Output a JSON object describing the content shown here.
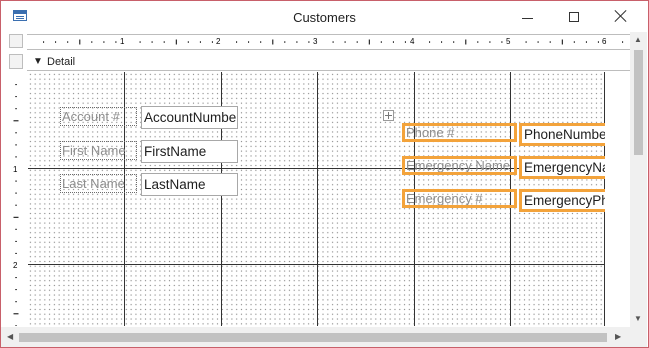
{
  "window": {
    "title": "Customers",
    "app_icon": "form-icon",
    "accent_border": "#c8606a"
  },
  "ruler": {
    "horizontal_marks": [
      "1",
      "2",
      "3",
      "4",
      "5",
      "6"
    ],
    "vertical_marks": [
      "1",
      "2"
    ]
  },
  "section": {
    "arrow": "▼",
    "label": "Detail"
  },
  "controls": {
    "account_label": "Account #",
    "account_field": "AccountNumber",
    "firstname_label": "First Name",
    "firstname_field": "FirstName",
    "lastname_label": "Last Name",
    "lastname_field": "LastName",
    "phone_label": "Phone #",
    "phone_field": "PhoneNumber",
    "emergency_name_label": "Emergency Name",
    "emergency_name_field": "EmergencyName",
    "emergency_phone_label": "Emergency #",
    "emergency_phone_field": "EmergencyPhone"
  },
  "selection_color": "#f3a33b",
  "scroll_arrows": {
    "up": "▲",
    "down": "▼",
    "left": "◀",
    "right": "▶"
  }
}
